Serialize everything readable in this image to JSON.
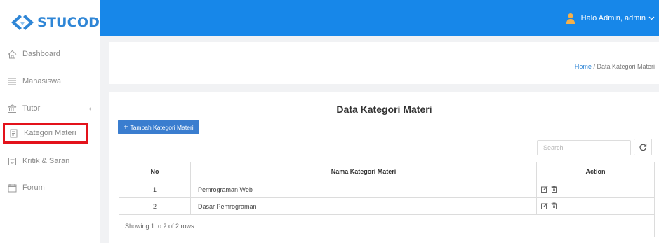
{
  "brand": {
    "logo_text": "STUCODE",
    "accent": "#2f86d6"
  },
  "header": {
    "user_label": "Halo Admin, admin",
    "bar_color": "#1787e9"
  },
  "sidebar": {
    "items": [
      {
        "label": "Dashboard",
        "icon": "home-icon"
      },
      {
        "label": "Mahasiswa",
        "icon": "list-icon"
      },
      {
        "label": "Tutor",
        "icon": "bank-icon",
        "has_submenu": true
      },
      {
        "label": "Kategori Materi",
        "icon": "book-icon",
        "highlighted": true
      },
      {
        "label": "Kritik & Saran",
        "icon": "inbox-icon"
      },
      {
        "label": "Forum",
        "icon": "forum-icon"
      }
    ],
    "submenu_chevron": "‹"
  },
  "breadcrumb": {
    "home": "Home",
    "separator": " / ",
    "current": "Data Kategori Materi"
  },
  "main": {
    "title": "Data Kategori Materi",
    "add_button": "Tambah Kategori Materi",
    "search": {
      "placeholder": "Search"
    },
    "table": {
      "headers": [
        "No",
        "Nama Kategori Materi",
        "Action"
      ],
      "rows": [
        {
          "no": "1",
          "name": "Pemrograman Web"
        },
        {
          "no": "2",
          "name": "Dasar Pemrograman"
        }
      ]
    },
    "footer_text": "Showing 1 to 2 of 2 rows"
  }
}
